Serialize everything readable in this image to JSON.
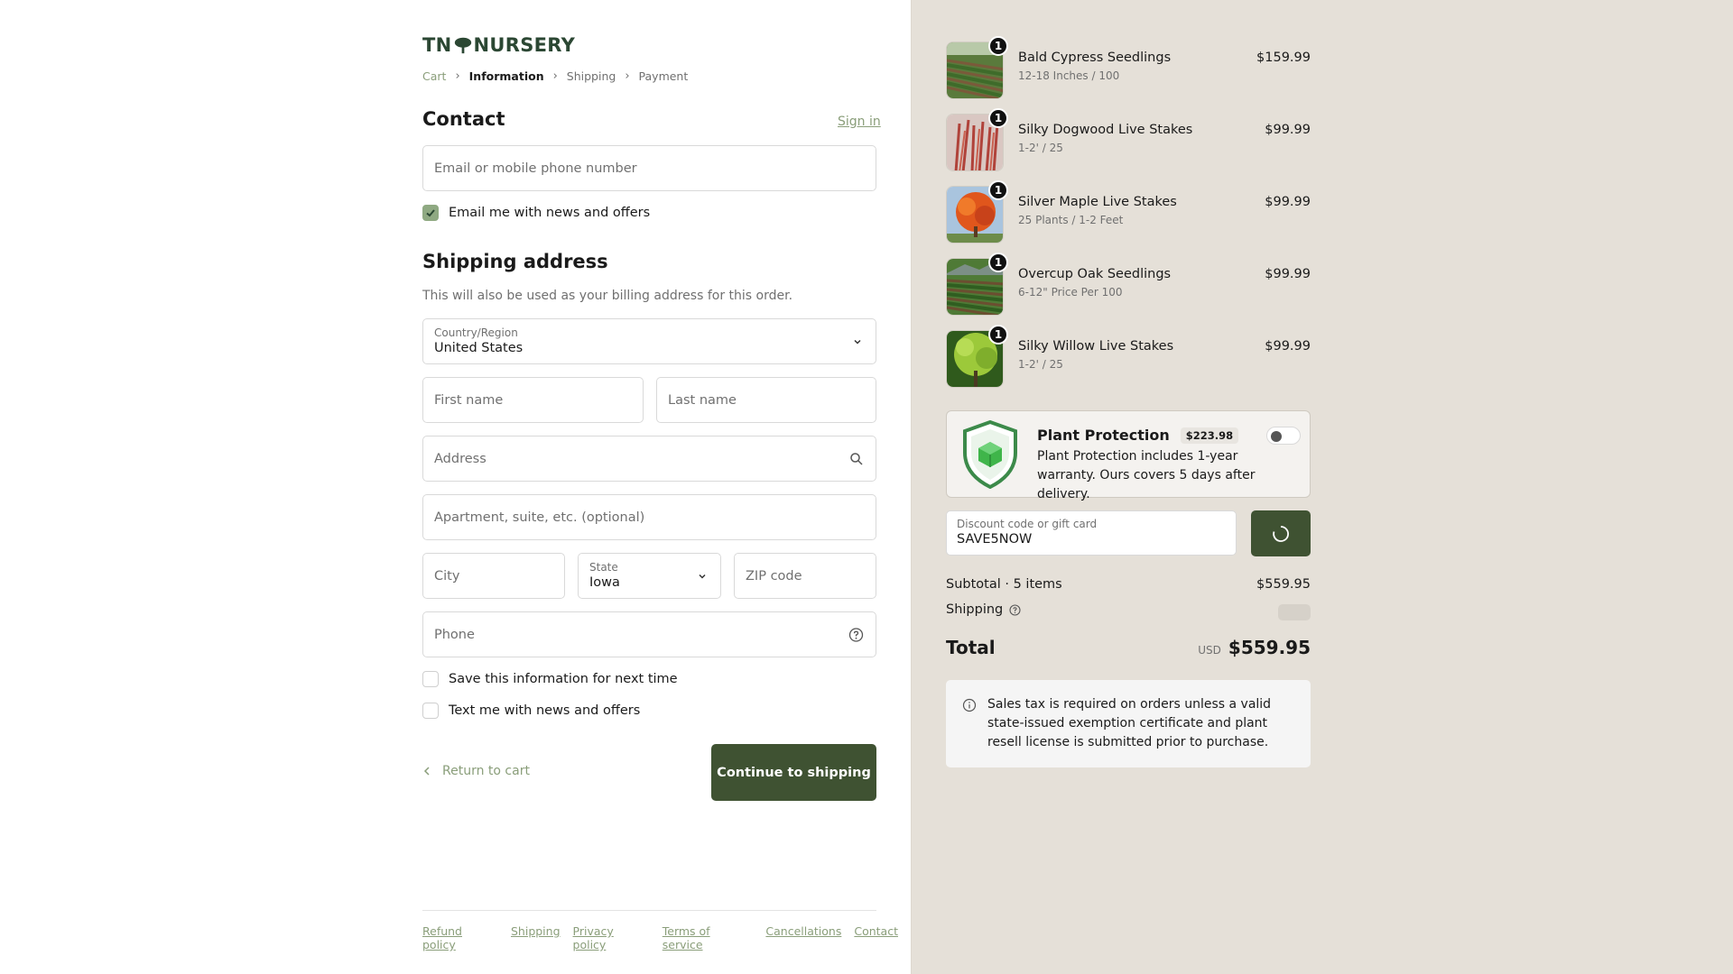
{
  "brand": {
    "logo_left": "TN",
    "logo_right": "NURSERY"
  },
  "breadcrumb": [
    "Cart",
    "Information",
    "Shipping",
    "Payment"
  ],
  "contact": {
    "title": "Contact",
    "signin": "Sign in",
    "email_placeholder": "Email or mobile phone number",
    "news_label": "Email me with news and offers",
    "news_checked": true
  },
  "shipping": {
    "title": "Shipping address",
    "note": "This will also be used as your billing address for this order.",
    "country_label": "Country/Region",
    "country_value": "United States",
    "first_name_placeholder": "First name",
    "last_name_placeholder": "Last name",
    "address_placeholder": "Address",
    "apartment_placeholder": "Apartment, suite, etc. (optional)",
    "city_placeholder": "City",
    "state_label": "State",
    "state_value": "Iowa",
    "zip_placeholder": "ZIP code",
    "phone_placeholder": "Phone",
    "save_label": "Save this information for next time",
    "text_label": "Text me with news and offers"
  },
  "actions": {
    "return_label": "Return to cart",
    "continue_label": "Continue to shipping"
  },
  "footer": [
    "Refund policy",
    "Shipping",
    "Privacy policy",
    "Terms of service",
    "Cancellations",
    "Contact"
  ],
  "cart": {
    "items": [
      {
        "name": "Bald Cypress Seedlings",
        "variant": "12-18 Inches / 100",
        "price": "$159.99",
        "qty": "1",
        "thumb": "seedling-rows-icon"
      },
      {
        "name": "Silky Dogwood Live Stakes",
        "variant": "1-2' / 25",
        "price": "$99.99",
        "qty": "1",
        "thumb": "red-stems-icon"
      },
      {
        "name": "Silver Maple Live Stakes",
        "variant": "25 Plants / 1-2 Feet",
        "price": "$99.99",
        "qty": "1",
        "thumb": "autumn-tree-icon"
      },
      {
        "name": "Overcup Oak Seedlings",
        "variant": "6-12\" Price Per 100",
        "price": "$99.99",
        "qty": "1",
        "thumb": "seedling-rows-icon"
      },
      {
        "name": "Silky Willow Live Stakes",
        "variant": "1-2' / 25",
        "price": "$99.99",
        "qty": "1",
        "thumb": "willow-icon"
      }
    ]
  },
  "protection": {
    "title": "Plant Protection",
    "price": "$223.98",
    "desc": "Plant Protection includes 1-year warranty. Ours covers 5 days after delivery.",
    "enabled": false
  },
  "discount": {
    "label": "Discount code or gift card",
    "value": "SAVE5NOW"
  },
  "summary": {
    "subtotal_label": "Subtotal · 5 items",
    "subtotal_value": "$559.95",
    "shipping_label": "Shipping",
    "total_label": "Total",
    "currency": "USD",
    "total_value": "$559.95"
  },
  "tax_note": "Sales tax is required on orders unless a valid state-issued exemption certificate and plant resell license is submitted prior to purchase.",
  "colors": {
    "accent": "#3f5232",
    "link": "#8a9e7a",
    "sidebar_bg": "#e5e0d8"
  }
}
